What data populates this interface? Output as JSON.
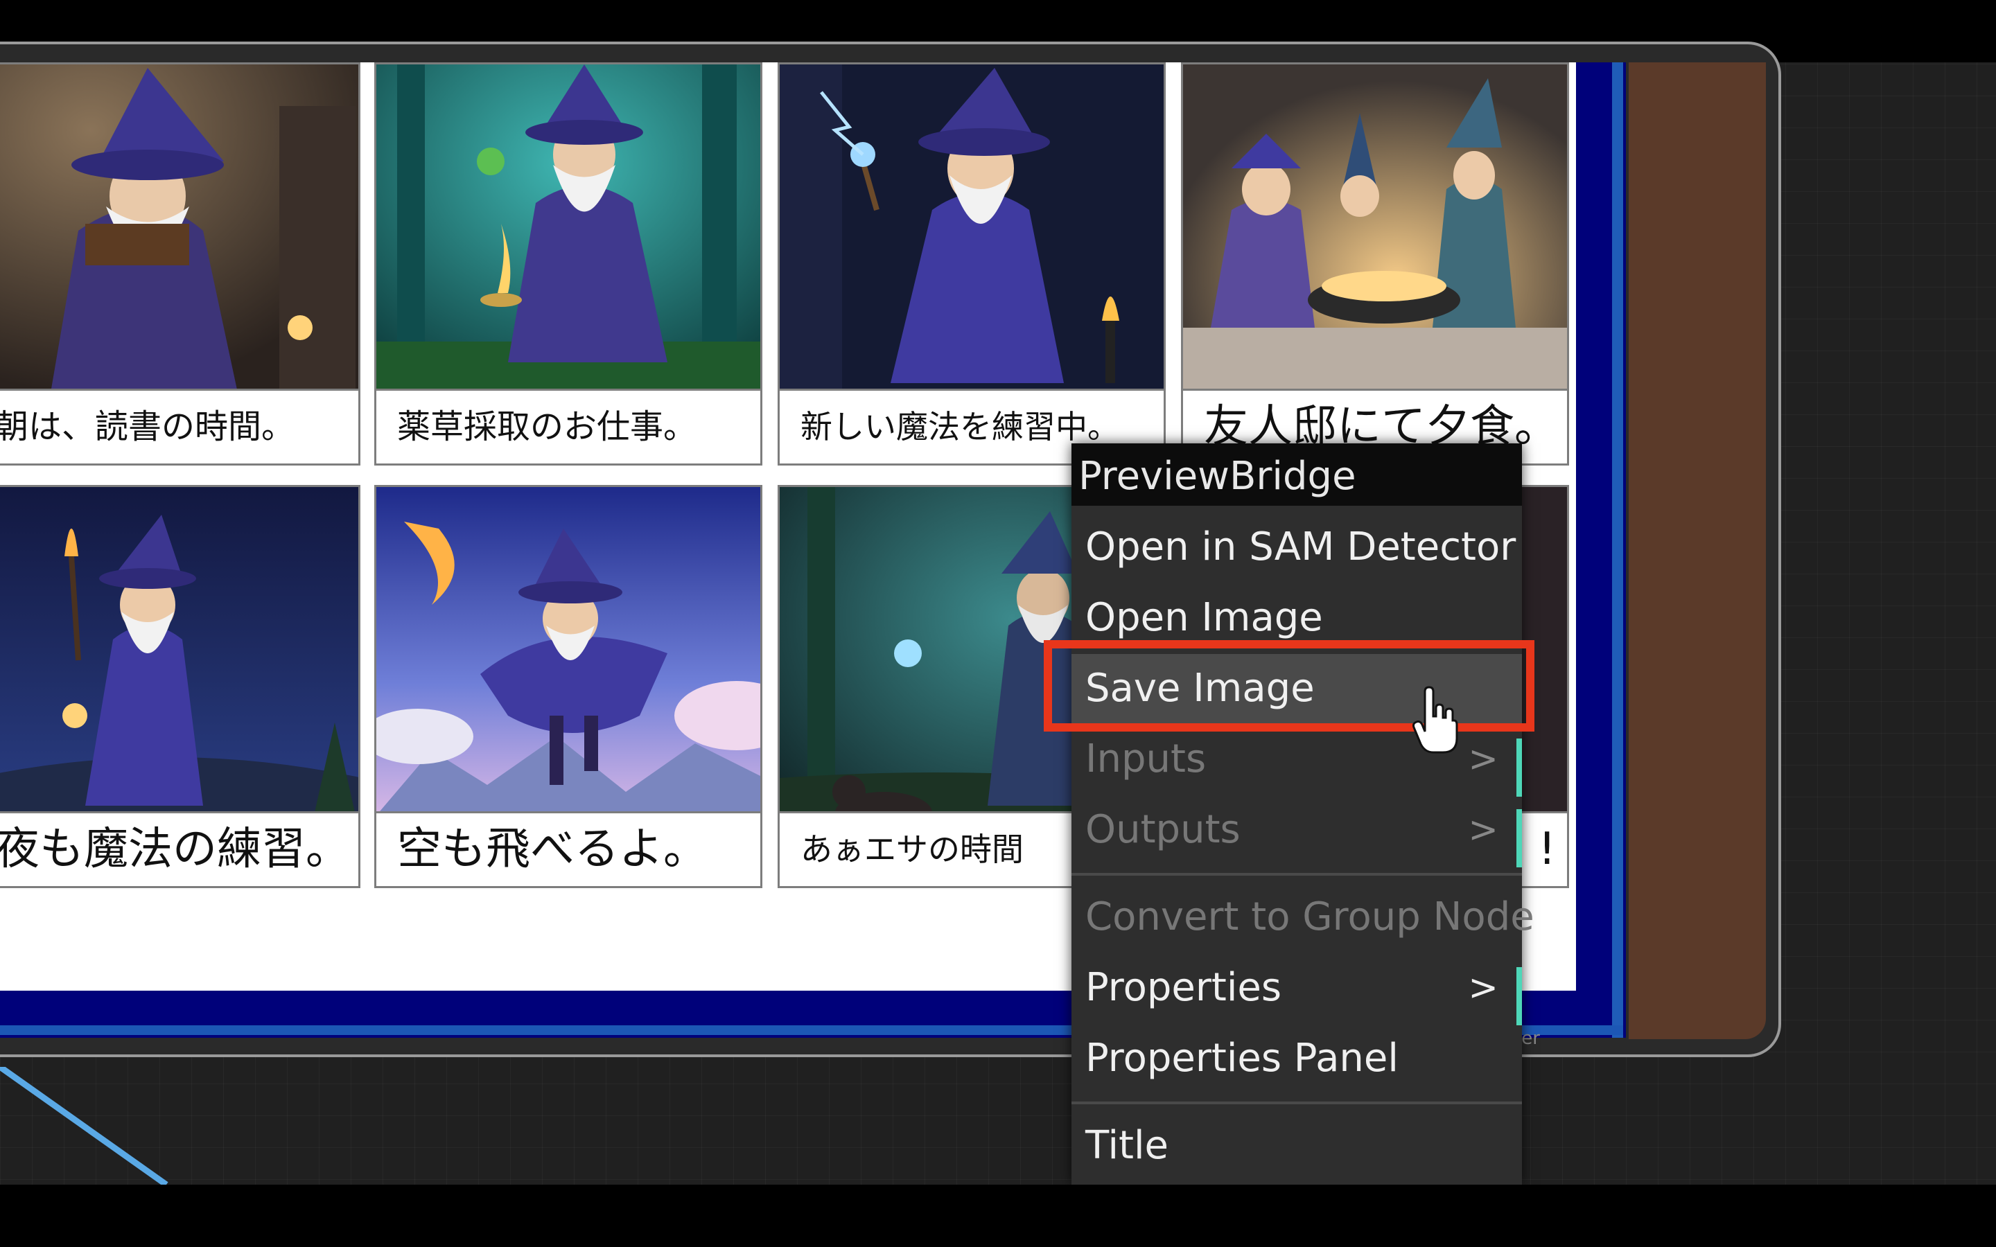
{
  "gallery": {
    "captions": [
      "朝は、読書の時間。",
      "薬草採取のお仕事。",
      "新しい魔法を練習中。",
      "友人邸にて夕食。",
      "夜も魔法の練習。",
      "空も飛べるよ。",
      "あぁエサの時間",
      "!"
    ],
    "watermark": "ier"
  },
  "context_menu": {
    "title": "PreviewBridge",
    "items": [
      {
        "label": "Open in SAM Detector"
      },
      {
        "label": "Open Image"
      },
      {
        "label": "Save Image"
      },
      {
        "label": "Inputs",
        "arrow": ">"
      },
      {
        "label": "Outputs",
        "arrow": ">"
      },
      {
        "label": "Convert to Group Node"
      },
      {
        "label": "Properties",
        "arrow": ">"
      },
      {
        "label": "Properties Panel"
      },
      {
        "label": "Title"
      }
    ]
  },
  "colors": {
    "highlight_box": "#e8361b",
    "node_blue": "#00017a",
    "menu_bg": "#2e2e2e"
  }
}
